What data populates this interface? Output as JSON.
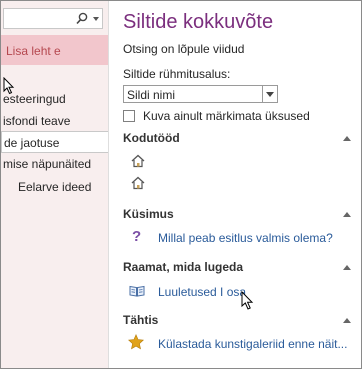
{
  "left_pane": {
    "add_page_label": "Lisa leht e",
    "pages": [
      {
        "label": "esteeringud",
        "indent": false,
        "selected": false
      },
      {
        "label": "isfondi teave",
        "indent": false,
        "selected": false
      },
      {
        "label": "de jaotuse",
        "indent": false,
        "selected": true
      },
      {
        "label": "mise näpunäited",
        "indent": false,
        "selected": false
      },
      {
        "label": "Eelarve ideed",
        "indent": true,
        "selected": false
      }
    ]
  },
  "summary": {
    "title": "Siltide kokkuvõte",
    "status": "Otsing on lõpule viidud",
    "group_by_label": "Siltide rühmitusalus:",
    "group_by_value": "Sildi nimi",
    "checkbox_label": "Kuva ainult märkimata üksused",
    "groups": [
      {
        "name": "Kodutööd",
        "items": [
          {
            "icon": "house-icon",
            "text": ""
          },
          {
            "icon": "house-icon",
            "text": ""
          }
        ]
      },
      {
        "name": "Küsimus",
        "items": [
          {
            "icon": "question-mark-icon",
            "text": "Millal peab esitlus valmis olema?"
          }
        ]
      },
      {
        "name": "Raamat, mida lugeda",
        "items": [
          {
            "icon": "book-icon",
            "text": "Luuletused I osa"
          }
        ]
      },
      {
        "name": "Tähtis",
        "items": [
          {
            "icon": "star-icon",
            "text": "Külastada kunstigaleriid enne näit..."
          }
        ]
      }
    ]
  },
  "colors": {
    "title": "#7b2f7e",
    "accent_pink": "#f2c6cc",
    "link": "#2a5b9a",
    "star": "#e0a21a",
    "question": "#7b4fa6"
  }
}
